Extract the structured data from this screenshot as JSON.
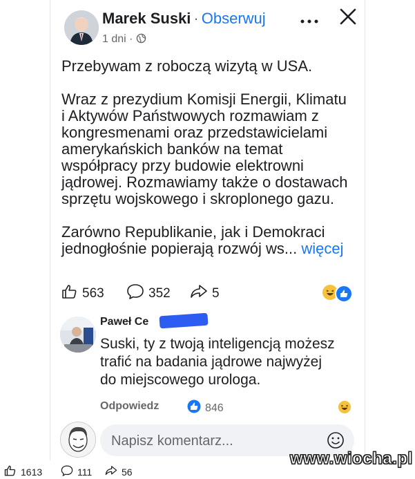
{
  "post": {
    "author": "Marek Suski",
    "separator": "·",
    "follow_label": "Obserwuj",
    "time": "1 dni",
    "meta_dot": "·",
    "more_icon": "more-icon",
    "close_icon": "close-icon",
    "paragraphs": [
      [
        "Przebywam z roboczą wizytą w USA."
      ],
      [
        "Wraz z prezydium Komisji Energii, Klimatu",
        "i Aktywów Państwowych rozmawiam z",
        "kongresmenami oraz przedstawicielami",
        "amerykańskich banków na temat",
        "współpracy przy budowie elektrowni",
        "jądrowej. Rozmawiamy także o dostawach",
        "sprzętu wojskowego i skroplonego gazu."
      ],
      [
        "Zarówno Republikanie, jak i Demokraci"
      ]
    ],
    "last_line": "jednogłośnie popierają rozwój ws...",
    "see_more": "więcej",
    "likes": "563",
    "comments": "352",
    "shares": "5"
  },
  "comment": {
    "author": "Paweł Ce",
    "lines": [
      "Suski, ty z twoją inteligencją możesz",
      "trafić na badania jądrowe najwyżej",
      "do  miejscowego urologa."
    ],
    "reply_label": "Odpowiedz",
    "likes": "846"
  },
  "composer": {
    "placeholder": "Napisz komentarz..."
  },
  "bottom": {
    "likes": "1613",
    "comments": "111",
    "shares": "56"
  },
  "watermark": "www.wiocha.pl",
  "colors": {
    "accent": "#1877f2",
    "muted": "#65676b"
  }
}
